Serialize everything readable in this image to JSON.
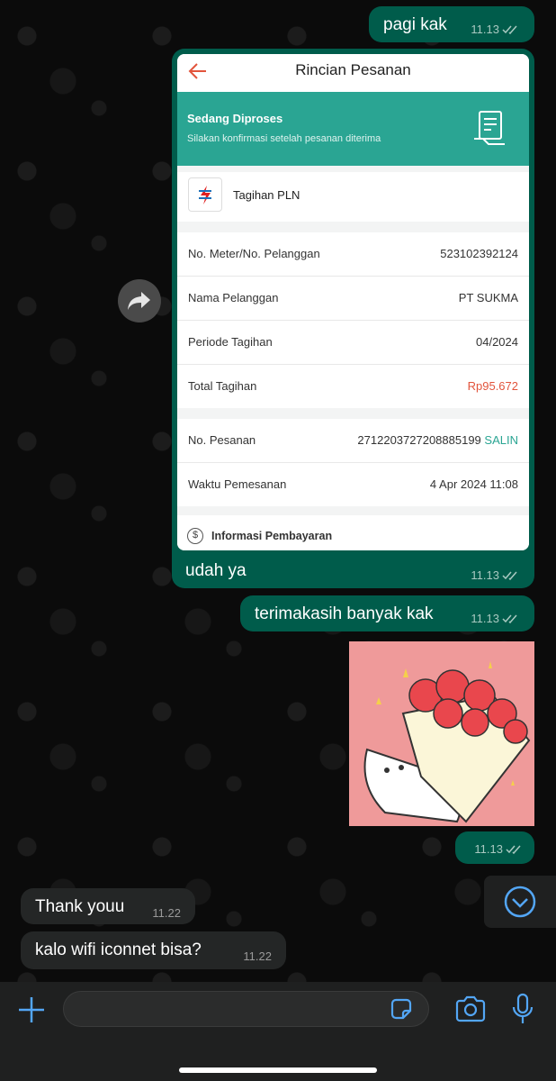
{
  "messages": {
    "m1": {
      "text": "pagi kak",
      "time": "11.13"
    },
    "m2": {
      "caption": "udah ya",
      "time": "11.13"
    },
    "m3": {
      "text": "terimakasih banyak kak",
      "time": "11.13"
    },
    "m4": {
      "time": "11.13"
    },
    "m5": {
      "text": "Thank youu",
      "time": "11.22"
    },
    "m6": {
      "text": "kalo wifi iconnet bisa?",
      "time": "11.22"
    }
  },
  "receipt": {
    "title": "Rincian Pesanan",
    "status_title": "Sedang Diproses",
    "status_subtitle": "Silakan konfirmasi setelah pesanan diterima",
    "biller": "Tagihan PLN",
    "rows": [
      {
        "label": "No. Meter/No. Pelanggan",
        "value": "523102392124"
      },
      {
        "label": "Nama Pelanggan",
        "value": "PT SUKMA"
      },
      {
        "label": "Periode Tagihan",
        "value": "04/2024"
      },
      {
        "label": "Total Tagihan",
        "value": "Rp95.672"
      }
    ],
    "order": {
      "label": "No. Pesanan",
      "value": "2712203727208885199",
      "copy_label": "SALIN"
    },
    "order_time": {
      "label": "Waktu Pemesanan",
      "value": "4 Apr 2024 11:08"
    },
    "payment_info": "Informasi Pembayaran",
    "accent_color": "#2aa593",
    "total_color": "#e2543c"
  },
  "colors": {
    "outgoing_bubble": "#005c4b",
    "incoming_bubble": "#242626",
    "accent_blue": "#53a6f5"
  },
  "icons": [
    "forward-icon",
    "scroll-down-icon",
    "plus-icon",
    "sticker-icon",
    "camera-icon",
    "mic-icon",
    "double-check-icon",
    "back-arrow-icon",
    "receipt-icon",
    "pln-logo",
    "dollar-icon"
  ]
}
